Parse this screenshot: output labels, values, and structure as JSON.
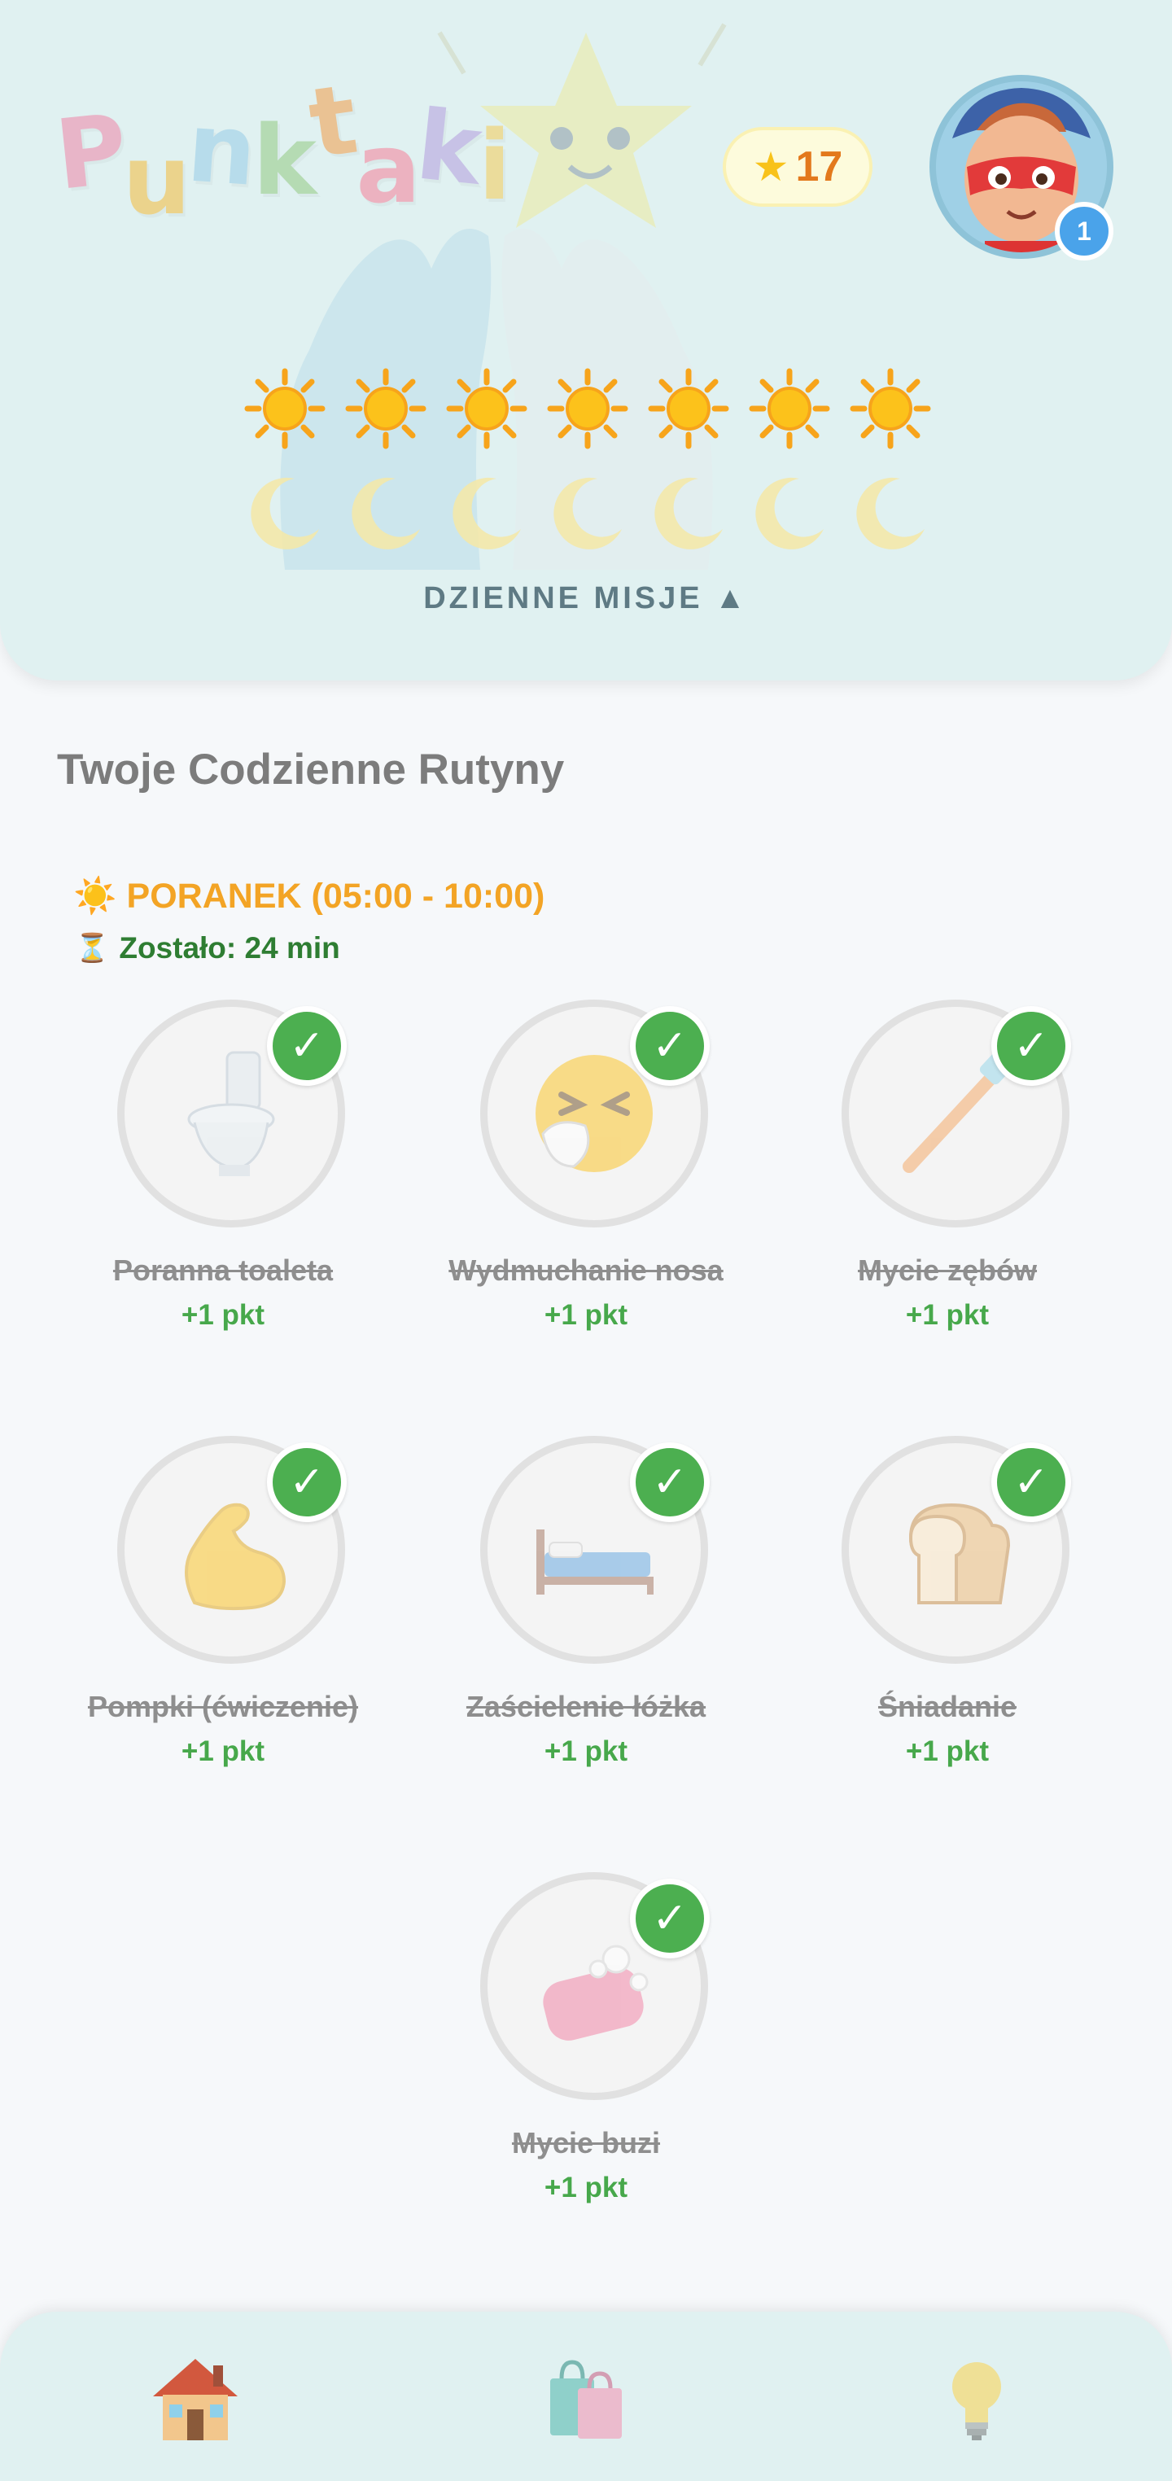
{
  "app": {
    "logo_text": "Punktaki"
  },
  "header": {
    "points": "17",
    "avatar_badge": "1",
    "daily_missions_label": "DZIENNE MISJE ▲",
    "days": [
      {
        "sun": "☀",
        "moon": "moon"
      },
      {
        "sun": "☀",
        "moon": "moon"
      },
      {
        "sun": "☀",
        "moon": "moon"
      },
      {
        "sun": "☀",
        "moon": "moon"
      },
      {
        "sun": "☀",
        "moon": "moon"
      },
      {
        "sun": "☀",
        "moon": "moon"
      },
      {
        "sun": "☀",
        "moon": "moon"
      }
    ]
  },
  "routines": {
    "title": "Twoje Codzienne Rutyny",
    "period": {
      "icon": "☀️",
      "label": "PORANEK (05:00 - 10:00)",
      "time_icon": "⏳",
      "time_left": "Zostało: 24 min"
    },
    "tasks": [
      {
        "name": "Poranna toaleta",
        "points": "+1 pkt",
        "icon": "toilet-icon",
        "done": true
      },
      {
        "name": "Wydmuchanie nosa",
        "points": "+1 pkt",
        "icon": "sneezing-face-icon",
        "done": true
      },
      {
        "name": "Mycie zębów",
        "points": "+1 pkt",
        "icon": "toothbrush-icon",
        "done": true
      },
      {
        "name": "Pompki (ćwiczenie)",
        "points": "+1 pkt",
        "icon": "flexed-biceps-icon",
        "done": true
      },
      {
        "name": "Zaścielenie łóżka",
        "points": "+1 pkt",
        "icon": "bed-icon",
        "done": true
      },
      {
        "name": "Śniadanie",
        "points": "+1 pkt",
        "icon": "bread-icon",
        "done": true
      },
      {
        "name": "Mycie buzi",
        "points": "+1 pkt",
        "icon": "soap-icon",
        "done": true
      }
    ],
    "check_mark": "✓"
  },
  "nav": {
    "items": [
      {
        "icon": "house-icon"
      },
      {
        "icon": "shopping-bags-icon"
      },
      {
        "icon": "light-bulb-icon"
      }
    ]
  },
  "colors": {
    "header_bg": "#e0f1f1",
    "accent_orange": "#f3a425",
    "success_green": "#4caf50",
    "points_text": "#e3791c"
  }
}
